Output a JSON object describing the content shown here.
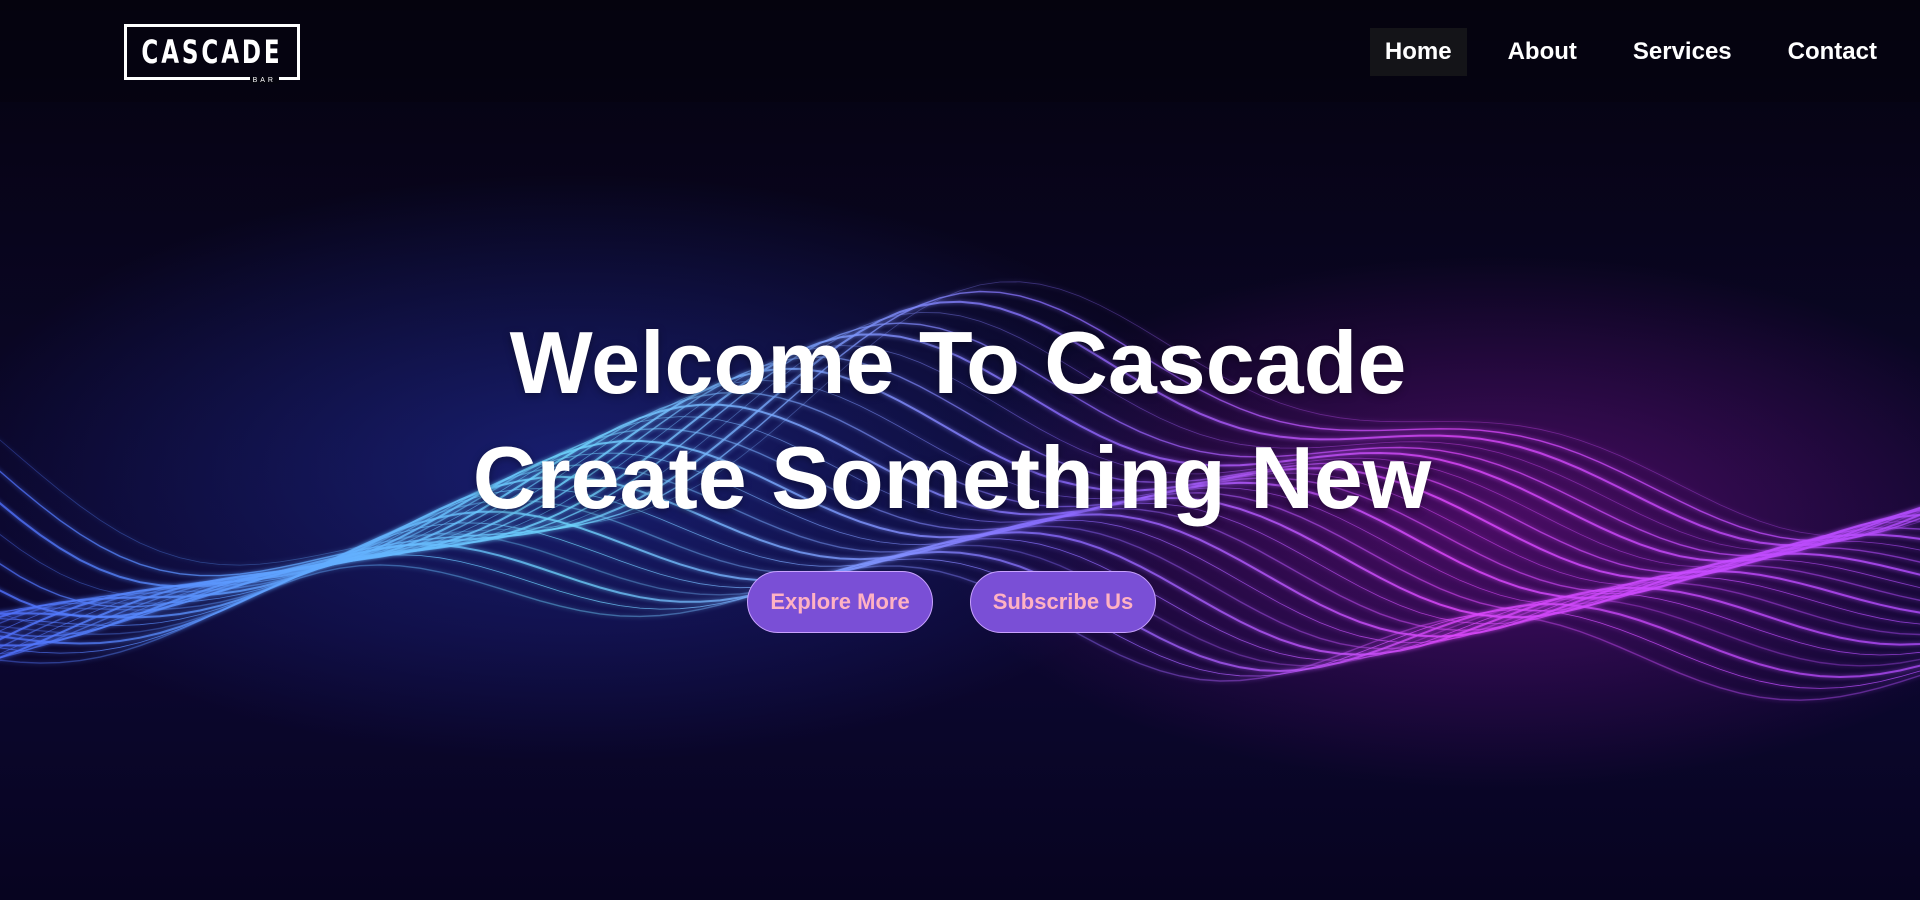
{
  "brand": {
    "name": "CASCADE",
    "tagline": "BAR"
  },
  "nav": {
    "items": [
      {
        "label": "Home",
        "active": true
      },
      {
        "label": "About",
        "active": false
      },
      {
        "label": "Services",
        "active": false
      },
      {
        "label": "Contact",
        "active": false
      }
    ]
  },
  "hero": {
    "title_line1": "Welcome To Cascade",
    "title_line2": "Create Something New",
    "buttons": {
      "explore": "Explore More",
      "subscribe": "Subscribe Us"
    }
  },
  "colors": {
    "background": "#07051a",
    "button_fill": "#7a4fd6",
    "button_text": "#ffb2c3",
    "wave_blue": "#4f7dff",
    "wave_cyan": "#7fe8ff",
    "wave_magenta": "#e048ff",
    "nav_active_bg": "#141418"
  }
}
